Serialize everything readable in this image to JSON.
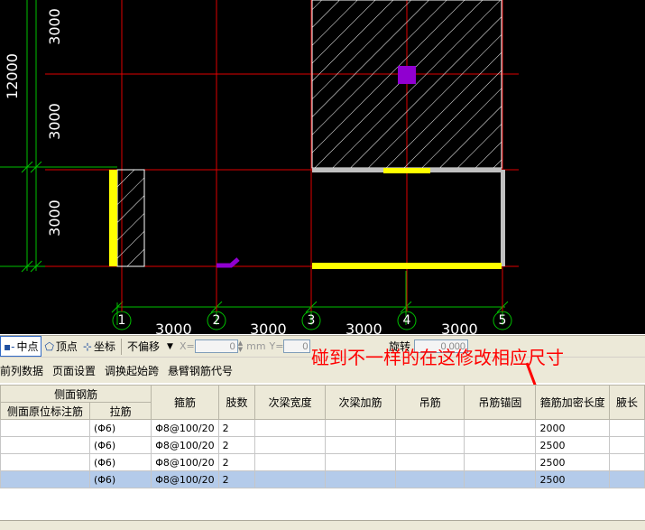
{
  "drawing": {
    "dims_vertical": [
      "3000",
      "3000",
      "3000",
      "12000"
    ],
    "dims_horizontal": [
      "3000",
      "3000",
      "3000",
      "3000"
    ],
    "axis_labels": [
      "1",
      "2",
      "3",
      "4",
      "5"
    ]
  },
  "toolbar": {
    "midpoint": "中点",
    "vertex": "顶点",
    "coordinate": "坐标",
    "offset_select": "不偏移",
    "x_label": "X=",
    "x_value": "0",
    "mm_label": "mm",
    "y_label": "Y=",
    "y_value": "0",
    "rotate_label": "旋转",
    "rotate_value": "0.000"
  },
  "menu": [
    "前列数据",
    "页面设置",
    "调换起始跨",
    "悬臂钢筋代号"
  ],
  "annotation": "碰到不一样的在这修改相应尺寸",
  "table": {
    "group_header": "侧面钢筋",
    "sub_headers": [
      "侧面原位标注筋",
      "拉筋"
    ],
    "headers": [
      "箍筋",
      "肢数",
      "次梁宽度",
      "次梁加筋",
      "吊筋",
      "吊筋锚固",
      "箍筋加密长度",
      "腋长"
    ],
    "rows": [
      {
        "side": "",
        "tie": "(Φ6)",
        "stirrup": "Φ8@100/20",
        "legs": "2",
        "w": "",
        "add": "",
        "hang": "",
        "anchor": "",
        "dense": "2000",
        "haunch": ""
      },
      {
        "side": "",
        "tie": "(Φ6)",
        "stirrup": "Φ8@100/20",
        "legs": "2",
        "w": "",
        "add": "",
        "hang": "",
        "anchor": "",
        "dense": "2500",
        "haunch": ""
      },
      {
        "side": "",
        "tie": "(Φ6)",
        "stirrup": "Φ8@100/20",
        "legs": "2",
        "w": "",
        "add": "",
        "hang": "",
        "anchor": "",
        "dense": "2500",
        "haunch": ""
      },
      {
        "side": "",
        "tie": "(Φ6)",
        "stirrup": "Φ8@100/20",
        "legs": "2",
        "w": "",
        "add": "",
        "hang": "",
        "anchor": "",
        "dense": "2500",
        "haunch": ""
      }
    ]
  }
}
